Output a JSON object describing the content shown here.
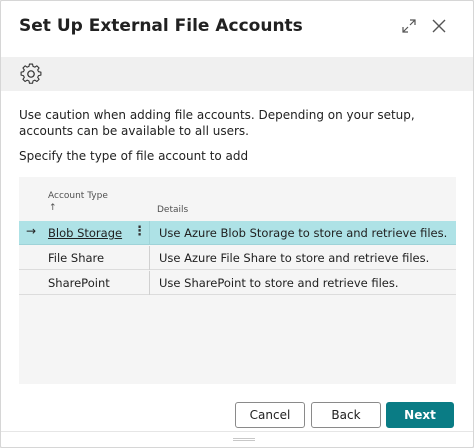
{
  "dialog": {
    "title": "Set Up External File Accounts"
  },
  "toolbar": {
    "settings_icon": "gear-icon"
  },
  "content": {
    "caution": "Use caution when adding file accounts. Depending on your setup, accounts can be available to all users.",
    "specify": "Specify the type of file account to add"
  },
  "grid": {
    "columns": {
      "account_type": "Account Type",
      "sort_indicator": "↑",
      "details": "Details"
    },
    "rows": [
      {
        "account_type": "Blob Storage",
        "details": "Use Azure Blob Storage to store and retrieve files.",
        "selected": true
      },
      {
        "account_type": "File Share",
        "details": "Use Azure File Share to store and retrieve files.",
        "selected": false
      },
      {
        "account_type": "SharePoint",
        "details": "Use SharePoint to store and retrieve files.",
        "selected": false
      }
    ],
    "row_pointer": "→",
    "row_actions": "⋮"
  },
  "buttons": {
    "cancel": "Cancel",
    "back": "Back",
    "next": "Next"
  },
  "colors": {
    "accent": "#0a7c85",
    "selected_row": "#aee2e6",
    "toolbar_bg": "#f0f0f0",
    "grid_bg": "#f5f5f5"
  }
}
